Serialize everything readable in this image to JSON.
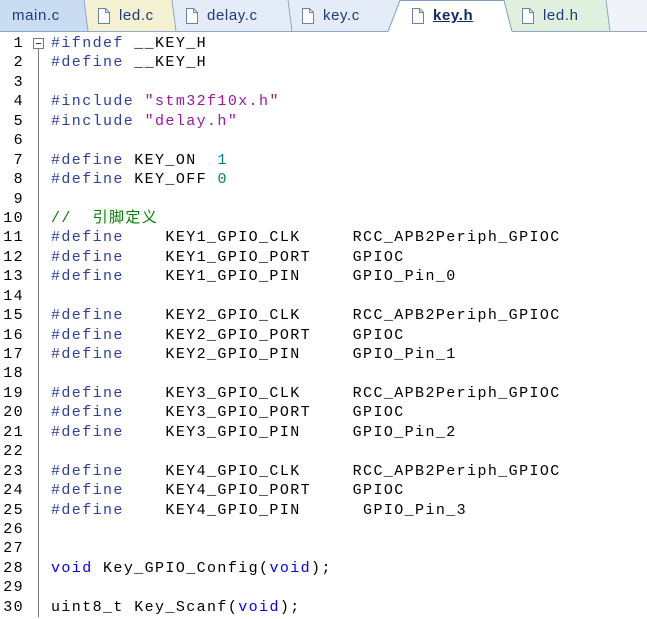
{
  "tabs": [
    {
      "label": "main.c",
      "active": false,
      "bg": "#c9dcf2"
    },
    {
      "label": "led.c",
      "active": false,
      "bg": "#f3f1d2",
      "icon": "file-icon"
    },
    {
      "label": "delay.c",
      "active": false,
      "bg": "#e4ecf7",
      "icon": "file-icon"
    },
    {
      "label": "key.c",
      "active": false,
      "bg": "#e4ecf7",
      "icon": "file-icon"
    },
    {
      "label": "key.h",
      "active": true,
      "bg": "#ffffff",
      "icon": "file-icon"
    },
    {
      "label": "led.h",
      "active": false,
      "bg": "#dff0df",
      "icon": "file-icon"
    }
  ],
  "editor": {
    "fold_icon": "fold-collapse-icon",
    "lines": [
      {
        "number": 1,
        "tokens": [
          {
            "text": "#ifndef",
            "color": "#2d3f9e"
          },
          {
            "text": " __KEY_H"
          }
        ]
      },
      {
        "number": 2,
        "tokens": [
          {
            "text": "#define",
            "color": "#2d3f9e"
          },
          {
            "text": " __KEY_H"
          }
        ]
      },
      {
        "number": 3,
        "tokens": []
      },
      {
        "number": 4,
        "tokens": [
          {
            "text": "#include",
            "color": "#2d3f9e"
          },
          {
            "text": " "
          },
          {
            "text": "\"stm32f10x.h\"",
            "color": "#9b1a9b"
          }
        ]
      },
      {
        "number": 5,
        "tokens": [
          {
            "text": "#include",
            "color": "#2d3f9e"
          },
          {
            "text": " "
          },
          {
            "text": "\"delay.h\"",
            "color": "#9b1a9b"
          }
        ]
      },
      {
        "number": 6,
        "tokens": []
      },
      {
        "number": 7,
        "tokens": [
          {
            "text": "#define",
            "color": "#2d3f9e"
          },
          {
            "text": " KEY_ON  "
          },
          {
            "text": "1",
            "color": "#008080"
          }
        ]
      },
      {
        "number": 8,
        "tokens": [
          {
            "text": "#define",
            "color": "#2d3f9e"
          },
          {
            "text": " KEY_OFF "
          },
          {
            "text": "0",
            "color": "#008080"
          }
        ]
      },
      {
        "number": 9,
        "tokens": []
      },
      {
        "number": 10,
        "tokens": [
          {
            "text": "//  引脚定义",
            "color": "#008000"
          }
        ]
      },
      {
        "number": 11,
        "tokens": [
          {
            "text": "#define",
            "color": "#2d3f9e"
          },
          {
            "text": "    KEY1_GPIO_CLK     RCC_APB2Periph_GPIOC"
          }
        ]
      },
      {
        "number": 12,
        "tokens": [
          {
            "text": "#define",
            "color": "#2d3f9e"
          },
          {
            "text": "    KEY1_GPIO_PORT    GPIOC"
          }
        ]
      },
      {
        "number": 13,
        "tokens": [
          {
            "text": "#define",
            "color": "#2d3f9e"
          },
          {
            "text": "    KEY1_GPIO_PIN     GPIO_Pin_0"
          }
        ]
      },
      {
        "number": 14,
        "tokens": []
      },
      {
        "number": 15,
        "tokens": [
          {
            "text": "#define",
            "color": "#2d3f9e"
          },
          {
            "text": "    KEY2_GPIO_CLK     RCC_APB2Periph_GPIOC"
          }
        ]
      },
      {
        "number": 16,
        "tokens": [
          {
            "text": "#define",
            "color": "#2d3f9e"
          },
          {
            "text": "    KEY2_GPIO_PORT    GPIOC"
          }
        ]
      },
      {
        "number": 17,
        "tokens": [
          {
            "text": "#define",
            "color": "#2d3f9e"
          },
          {
            "text": "    KEY2_GPIO_PIN     GPIO_Pin_1"
          }
        ]
      },
      {
        "number": 18,
        "tokens": []
      },
      {
        "number": 19,
        "tokens": [
          {
            "text": "#define",
            "color": "#2d3f9e"
          },
          {
            "text": "    KEY3_GPIO_CLK     RCC_APB2Periph_GPIOC"
          }
        ]
      },
      {
        "number": 20,
        "tokens": [
          {
            "text": "#define",
            "color": "#2d3f9e"
          },
          {
            "text": "    KEY3_GPIO_PORT    GPIOC"
          }
        ]
      },
      {
        "number": 21,
        "tokens": [
          {
            "text": "#define",
            "color": "#2d3f9e"
          },
          {
            "text": "    KEY3_GPIO_PIN     GPIO_Pin_2"
          }
        ]
      },
      {
        "number": 22,
        "tokens": []
      },
      {
        "number": 23,
        "tokens": [
          {
            "text": "#define",
            "color": "#2d3f9e"
          },
          {
            "text": "    KEY4_GPIO_CLK     RCC_APB2Periph_GPIOC"
          }
        ]
      },
      {
        "number": 24,
        "tokens": [
          {
            "text": "#define",
            "color": "#2d3f9e"
          },
          {
            "text": "    KEY4_GPIO_PORT    GPIOC"
          }
        ]
      },
      {
        "number": 25,
        "tokens": [
          {
            "text": "#define",
            "color": "#2d3f9e"
          },
          {
            "text": "    KEY4_GPIO_PIN      GPIO_Pin_3"
          }
        ]
      },
      {
        "number": 26,
        "tokens": []
      },
      {
        "number": 27,
        "tokens": []
      },
      {
        "number": 28,
        "tokens": [
          {
            "text": "void",
            "color": "#0000ff"
          },
          {
            "text": " Key_GPIO_Config("
          },
          {
            "text": "void",
            "color": "#0000ff"
          },
          {
            "text": ");"
          }
        ]
      },
      {
        "number": 29,
        "tokens": []
      },
      {
        "number": 30,
        "tokens": [
          {
            "text": "uint8_t Key_Scanf("
          },
          {
            "text": "void",
            "color": "#0000ff"
          },
          {
            "text": ");"
          }
        ]
      }
    ]
  }
}
